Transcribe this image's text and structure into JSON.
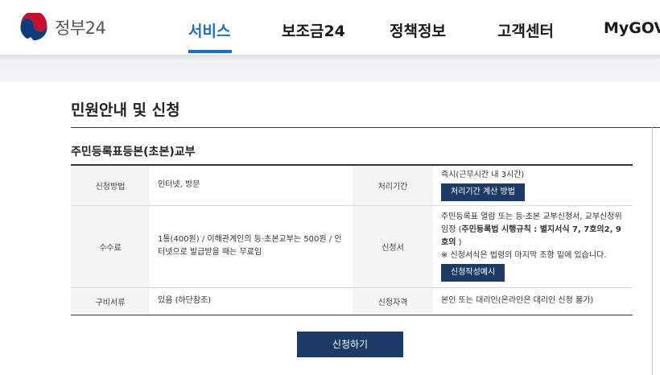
{
  "header": {
    "logo_text": "정부24",
    "nav": [
      {
        "label": "서비스",
        "active": true
      },
      {
        "label": "보조금24",
        "active": false
      },
      {
        "label": "정책정보",
        "active": false
      },
      {
        "label": "고객센터",
        "active": false
      },
      {
        "label": "MyGOV",
        "active": false
      }
    ]
  },
  "main": {
    "page_title": "민원안내 및 신청",
    "section_title": "주민등록표등본(초본)교부",
    "rows": [
      {
        "label1": "신청방법",
        "value1": "인터넷, 방문",
        "label2": "처리기간",
        "value2": "즉시(근무시간 내 3시간)",
        "button2": "처리기간 계산 방법"
      },
      {
        "label1": "수수료",
        "value1": "1통(400원) / 이해관계인의 등·초본교부는 500원 / 인터넷으로 발급받을 때는 무료임",
        "label2": "신청서",
        "value2_prefix": "주민등록표 열람 또는 등·초본 교부신청서, 교부신청위임장 (",
        "value2_bold": "주민등록법 시행규칙 : 별지서식 7, 7호의2, 9호의",
        "value2_suffix": ")",
        "value2_note": "※ 신청서식은 법령의 마지막 조항 밑에 있습니다.",
        "button2": "신청작성예시"
      },
      {
        "label1": "구비서류",
        "value1": "있음 (하단참조)",
        "label2": "신청자격",
        "value2": "본인 또는 대리인(온라인은 대리인 신청 불가)"
      }
    ],
    "apply_button": "신청하기"
  },
  "colors": {
    "accent": "#1a6fd0",
    "button_navy": "#1c3b66",
    "header_band": "#f4f4f6"
  }
}
